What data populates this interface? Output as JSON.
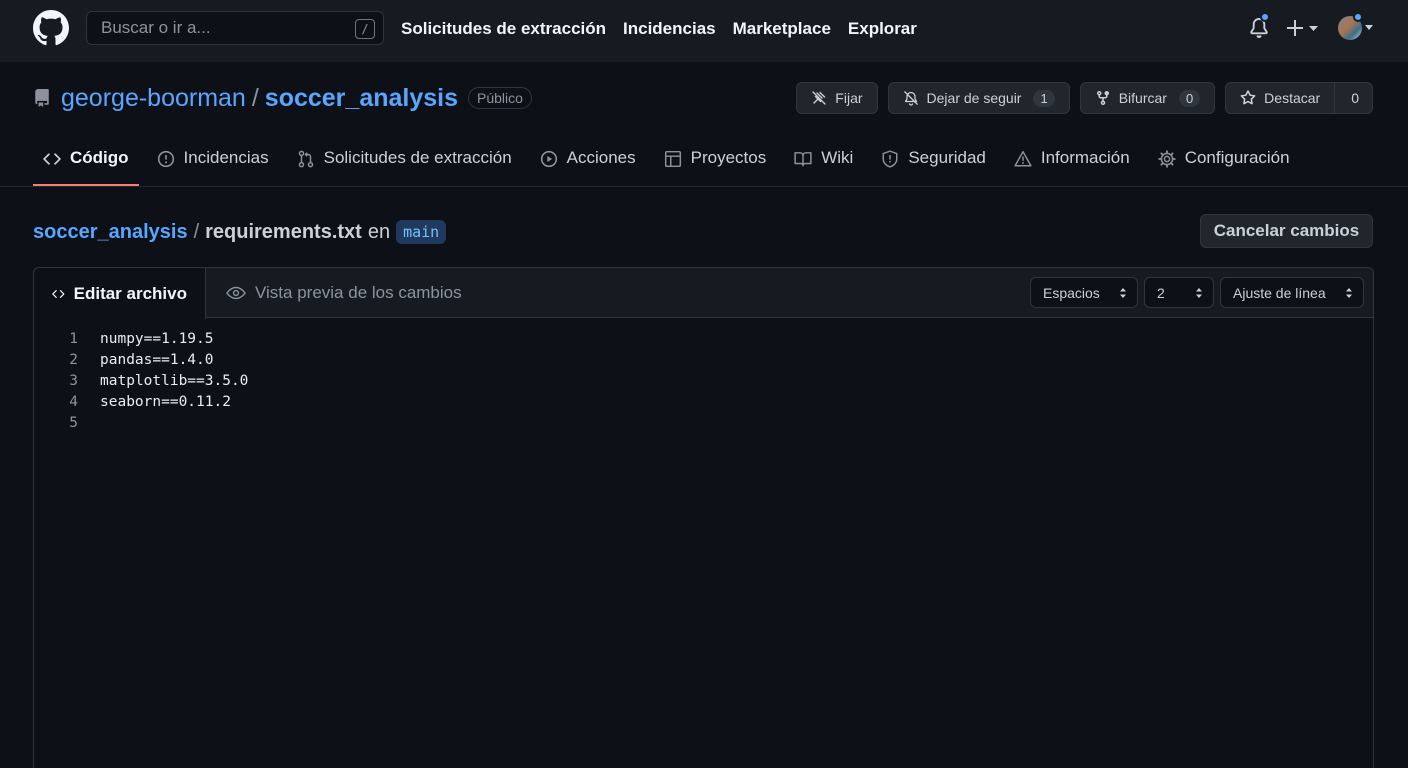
{
  "header": {
    "search_placeholder": "Buscar o ir a...",
    "search_shortcut": "/",
    "nav": [
      "Solicitudes de extracción",
      "Incidencias",
      "Marketplace",
      "Explorar"
    ],
    "icons": [
      "github-logo-icon",
      "bell-icon",
      "plus-icon",
      "avatar"
    ]
  },
  "repo": {
    "owner": "george-boorman",
    "separator": "/",
    "name": "soccer_analysis",
    "visibility": "Público",
    "actions": {
      "pin": "Fijar",
      "unwatch": "Dejar de seguir",
      "unwatch_count": "1",
      "fork": "Bifurcar",
      "fork_count": "0",
      "star": "Destacar",
      "star_count": "0"
    }
  },
  "tabs": [
    {
      "label": "Código",
      "icon": "code-icon",
      "active": true
    },
    {
      "label": "Incidencias",
      "icon": "issue-icon"
    },
    {
      "label": "Solicitudes de extracción",
      "icon": "pull-request-icon"
    },
    {
      "label": "Acciones",
      "icon": "play-icon"
    },
    {
      "label": "Proyectos",
      "icon": "table-icon"
    },
    {
      "label": "Wiki",
      "icon": "book-icon"
    },
    {
      "label": "Seguridad",
      "icon": "shield-icon"
    },
    {
      "label": "Información",
      "icon": "graph-icon"
    },
    {
      "label": "Configuración",
      "icon": "gear-icon"
    }
  ],
  "breadcrumb": {
    "repo": "soccer_analysis",
    "sep": "/",
    "file": "requirements.txt",
    "en": "en",
    "branch": "main"
  },
  "cancel_label": "Cancelar cambios",
  "editor": {
    "edit_tab": "Editar archivo",
    "preview_tab": "Vista previa de los cambios",
    "indent_mode": "Espacios",
    "indent_size": "2",
    "wrap_mode": "Ajuste de línea",
    "lines": [
      {
        "n": "1",
        "text": "numpy==1.19.5"
      },
      {
        "n": "2",
        "text": "pandas==1.4.0"
      },
      {
        "n": "3",
        "text": "matplotlib==3.5.0"
      },
      {
        "n": "4",
        "text": "seaborn==0.11.2"
      },
      {
        "n": "5",
        "text": ""
      }
    ]
  }
}
